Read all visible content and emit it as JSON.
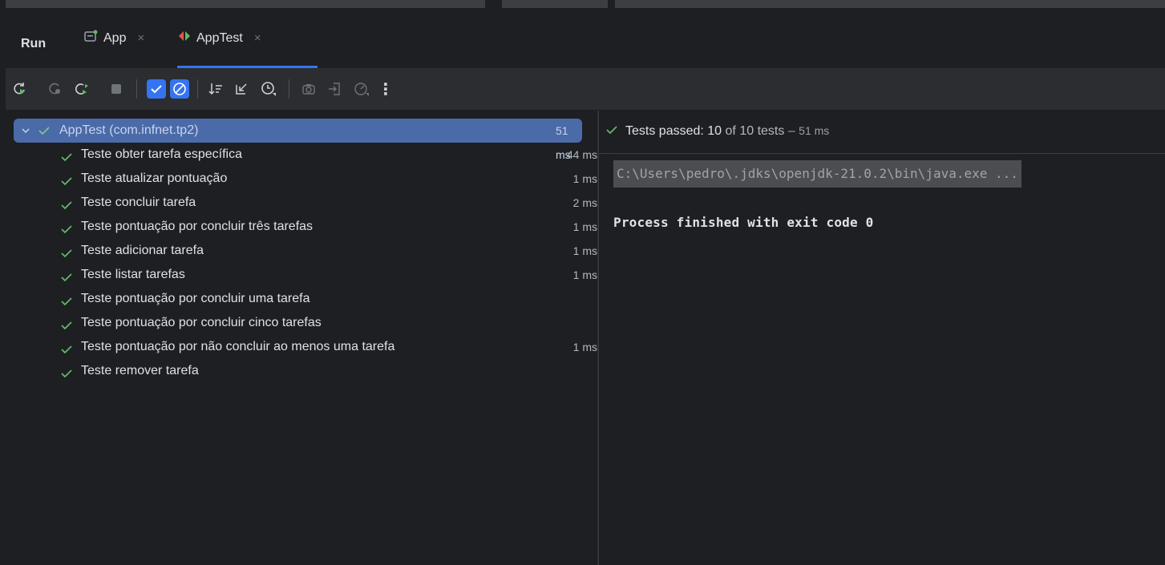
{
  "panel": {
    "title": "Run"
  },
  "tabs": [
    {
      "label": "App",
      "close": "×",
      "icon": "app-config-icon"
    },
    {
      "label": "AppTest",
      "close": "×",
      "icon": "test-config-icon",
      "active": true
    }
  ],
  "toolbar": {
    "icons": [
      "rerun-icon",
      "rerun-failed-icon",
      "toggle-auto-test-icon",
      "stop-icon",
      "show-passed-icon",
      "show-ignored-icon",
      "sort-alphabetically-icon",
      "collapse-all-icon",
      "sort-duration-icon",
      "export-icon",
      "import-icon",
      "coverage-icon",
      "more-icon"
    ],
    "more_label": "⋮"
  },
  "tree": {
    "root": {
      "label": "AppTest (com.infnet.tp2)",
      "time": "51 ms"
    },
    "items": [
      {
        "label": "Teste obter tarefa específica",
        "time": "44 ms"
      },
      {
        "label": "Teste atualizar pontuação",
        "time": "1 ms"
      },
      {
        "label": "Teste concluir tarefa",
        "time": "2 ms"
      },
      {
        "label": "Teste pontuação por concluir três tarefas",
        "time": "1 ms"
      },
      {
        "label": "Teste adicionar tarefa",
        "time": "1 ms"
      },
      {
        "label": "Teste listar tarefas",
        "time": "1 ms"
      },
      {
        "label": "Teste pontuação por concluir uma tarefa",
        "time": ""
      },
      {
        "label": "Teste pontuação por concluir cinco tarefas",
        "time": ""
      },
      {
        "label": "Teste pontuação por não concluir ao menos uma tarefa",
        "time": "1 ms"
      },
      {
        "label": "Teste remover tarefa",
        "time": ""
      }
    ]
  },
  "status": {
    "prefix": "Tests passed:",
    "passed": "10",
    "of": "of 10 tests",
    "dash": "–",
    "duration": "51 ms"
  },
  "console": {
    "command": "C:\\Users\\pedro\\.jdks\\openjdk-21.0.2\\bin\\java.exe ...",
    "exit": "Process finished with exit code 0"
  },
  "colors": {
    "accent": "#3574f0",
    "pass": "#5fb865",
    "selected": "#4a6aa8"
  }
}
